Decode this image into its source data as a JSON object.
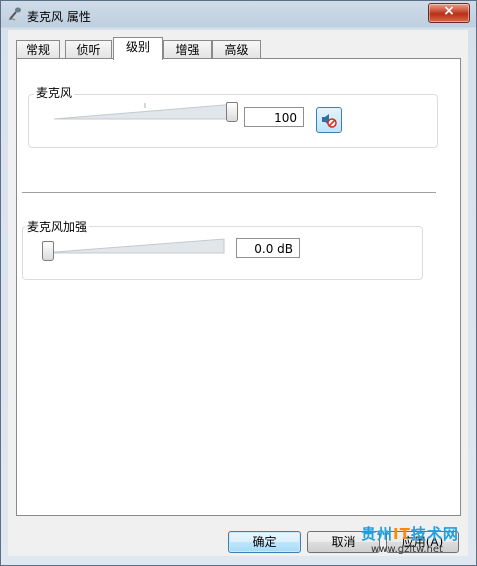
{
  "window": {
    "title": "麦克风 属性"
  },
  "tabs": [
    {
      "label": "常规",
      "active": false
    },
    {
      "label": "侦听",
      "active": false
    },
    {
      "label": "级别",
      "active": true
    },
    {
      "label": "增强",
      "active": false
    },
    {
      "label": "高级",
      "active": false
    }
  ],
  "microphone": {
    "label": "麦克风",
    "level_fraction": 1.0,
    "value": "100",
    "mute_icon": "speaker-muted-icon"
  },
  "boost": {
    "label": "麦克风加强",
    "level_fraction": 0.0,
    "value": "0.0 dB"
  },
  "buttons": {
    "ok": "确定",
    "cancel": "取消",
    "apply": "应用(A)"
  },
  "watermark": {
    "brand_part1": "贵州",
    "brand_it": "IT",
    "brand_part2": "技术网",
    "url": "www.gzitw.net"
  },
  "colors": {
    "accent": "#3c7fb1",
    "close": "#c6452d",
    "watermark_blue": "#1fa0e0",
    "watermark_orange": "#ff8a00"
  }
}
